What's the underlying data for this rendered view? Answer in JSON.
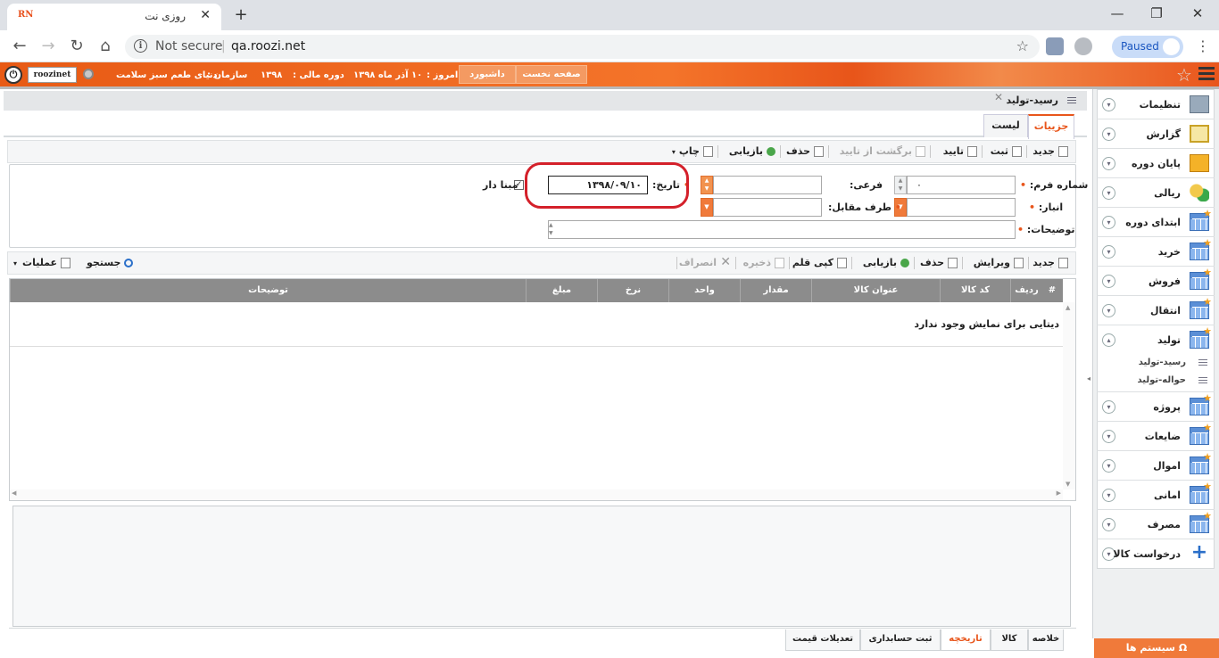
{
  "browser": {
    "tab_title": "روزی نت",
    "tab_favicon": "RN",
    "new_tab": "+",
    "security": "Not secure",
    "url": "qa.roozi.net",
    "profile_status": "Paused",
    "minimize": "—",
    "maximize": "❐",
    "close": "✕"
  },
  "header": {
    "username": "roozinet",
    "org_label": "سازمان :",
    "org_value": "دنیای طعم سبز سلامت",
    "fiscal_label": "دوره مالی :",
    "fiscal_value": "۱۳۹۸",
    "today_label": "امروز :",
    "today_value": "۱۰ آذر ماه ۱۳۹۸",
    "dashboard": "داشبورد",
    "home": "صفحه نخست"
  },
  "sidebar": {
    "items": [
      {
        "label": "تنظیمات",
        "icon": "settings-folder-icon"
      },
      {
        "label": "گزارش",
        "icon": "clipboard-icon"
      },
      {
        "label": "پایان دوره",
        "icon": "folders-icon"
      },
      {
        "label": "ریالی",
        "icon": "coins-icon"
      },
      {
        "label": "ابتدای دوره",
        "icon": "grid-icon"
      },
      {
        "label": "خرید",
        "icon": "grid-icon"
      },
      {
        "label": "فروش",
        "icon": "grid-icon"
      },
      {
        "label": "انتقال",
        "icon": "grid-icon"
      },
      {
        "label": "تولید",
        "icon": "grid-icon"
      },
      {
        "label": "پروژه",
        "icon": "grid-icon"
      },
      {
        "label": "ضایعات",
        "icon": "grid-icon"
      },
      {
        "label": "اموال",
        "icon": "grid-icon"
      },
      {
        "label": "امانی",
        "icon": "grid-icon"
      },
      {
        "label": "مصرف",
        "icon": "grid-icon"
      },
      {
        "label": "درخواست کالا",
        "icon": "plus-icon"
      }
    ],
    "subitems": [
      "رسید-تولید",
      "حواله-تولید"
    ],
    "system_button": "سیستم ها"
  },
  "page": {
    "title": "رسید-تولید",
    "tabs": [
      "جزییات",
      "لیست"
    ]
  },
  "toolbar1": {
    "new": "جدید",
    "save": "ثبت",
    "approve": "تایید",
    "unapprove": "برگشت از تایید",
    "delete": "حذف",
    "refresh": "بازیابی",
    "print": "چاپ"
  },
  "form": {
    "form_no_label": "شماره فرم:",
    "form_no_value": "۰",
    "sub_label": "فرعی:",
    "date_label": "تاریخ:",
    "date_value": "۱۳۹۸/۰۹/۱۰",
    "base_label": "مبنا دار",
    "warehouse_label": "انبار:",
    "counterparty_label": "طرف مقابل:",
    "description_label": "توضیحات:"
  },
  "toolbar2": {
    "new": "جدید",
    "edit": "ویرایش",
    "delete": "حذف",
    "refresh": "بازیابی",
    "copy": "کپی قلم",
    "save": "ذخیره",
    "cancel": "انصراف",
    "search": "جستجو",
    "operations": "عملیات"
  },
  "grid": {
    "columns": [
      "#",
      "ردیف",
      "کد کالا",
      "عنوان کالا",
      "مقدار",
      "واحد",
      "نرخ",
      "مبلغ",
      "توضیحات"
    ],
    "empty_message": "دیتایی برای نمایش وجود ندارد"
  },
  "bottom_tabs": [
    "خلاصه",
    "کالا",
    "تاریخچه",
    "ثبت حسابداری",
    "تعدیلات قیمت"
  ]
}
